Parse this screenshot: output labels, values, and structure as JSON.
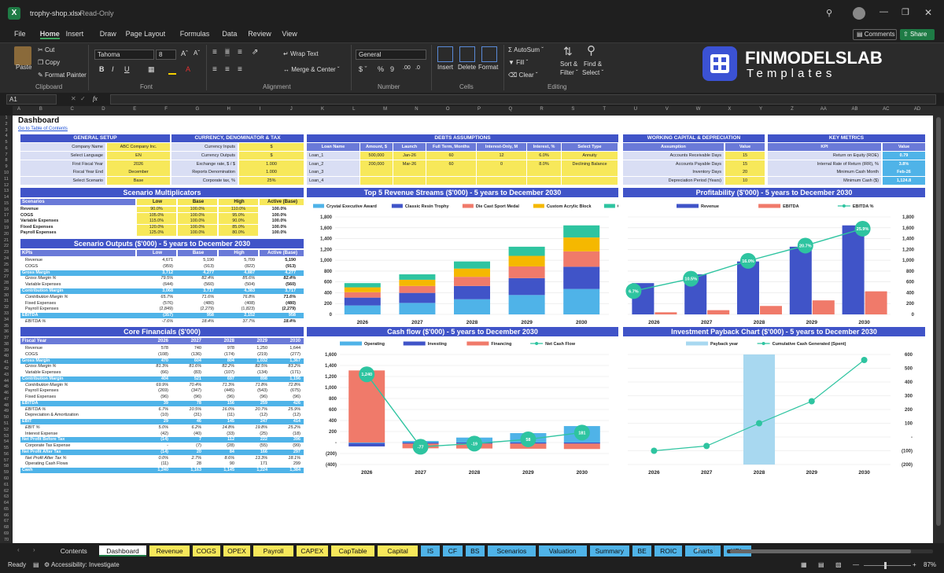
{
  "app": {
    "file": "trophy-shop.xlsx",
    "mode": "Read-Only",
    "comments": "Comments",
    "share": "Share"
  },
  "menu": [
    "File",
    "Home",
    "Insert",
    "Draw",
    "Page Layout",
    "Formulas",
    "Data",
    "Review",
    "View"
  ],
  "ribbon": {
    "cut": "Cut",
    "copy": "Copy",
    "format_painter": "Format Painter",
    "paste": "Paste",
    "clipboard": "Clipboard",
    "font_name": "Tahoma",
    "font_size": "8",
    "font": "Font",
    "wrap": "Wrap Text",
    "merge": "Merge & Center",
    "alignment": "Alignment",
    "number_format": "General",
    "number": "Number",
    "insert": "Insert",
    "delete": "Delete",
    "format": "Format",
    "cells": "Cells",
    "autosum": "AutoSum",
    "fill": "Fill",
    "clear": "Clear",
    "sort": "Sort &",
    "filter": "Filter",
    "find": "Find &",
    "select": "Select",
    "editing": "Editing"
  },
  "logo": {
    "name": "FINMODELSLAB",
    "sub": "Templates"
  },
  "formula": {
    "cell": "A1",
    "fx": "fx"
  },
  "columns": [
    "A",
    "B",
    "C",
    "D",
    "E",
    "F",
    "G",
    "H",
    "I",
    "J",
    "K",
    "L",
    "M",
    "N",
    "O",
    "P",
    "Q",
    "R",
    "S",
    "T",
    "U",
    "V",
    "W",
    "X",
    "Y",
    "Z",
    "AA",
    "AB",
    "AC",
    "AD"
  ],
  "rows": [
    "1",
    "2",
    "3",
    "4",
    "5",
    "6",
    "7",
    "8",
    "9",
    "10",
    "11",
    "12",
    "13",
    "14",
    "15",
    "16",
    "17",
    "18",
    "19",
    "20",
    "21",
    "22",
    "23",
    "24",
    "25",
    "26",
    "27",
    "28",
    "29",
    "30",
    "31",
    "32",
    "33",
    "34",
    "35",
    "36",
    "37",
    "38",
    "39",
    "40",
    "41",
    "42",
    "43",
    "44",
    "45",
    "46",
    "47",
    "48",
    "49",
    "50",
    "51",
    "52",
    "53",
    "54",
    "55",
    "56",
    "57",
    "58",
    "59",
    "60",
    "61",
    "62",
    "63",
    "64",
    "65",
    "66",
    "67",
    "68",
    "69",
    "70"
  ],
  "dashboard": {
    "title": "Dashboard",
    "link": "Go to Table of Contents"
  },
  "general_setup": {
    "title": "GENERAL SETUP",
    "rows": [
      [
        "Company Name",
        "ABC Company Inc."
      ],
      [
        "Select Language",
        "EN"
      ],
      [
        "First Fiscal Year",
        "2026"
      ],
      [
        "Fiscal Year End",
        "December"
      ],
      [
        "Select Scenario",
        "Base"
      ]
    ]
  },
  "currency": {
    "title": "CURRENCY, DENOMINATOR & TAX",
    "rows": [
      [
        "Currency Inputs",
        "$"
      ],
      [
        "Currency Outputs",
        "$"
      ],
      [
        "Exchange rate, $ / $",
        "1.000"
      ],
      [
        "Reports Denomination",
        "1.000"
      ],
      [
        "Corporate tax, %",
        "25%"
      ]
    ]
  },
  "debts": {
    "title": "DEBTS ASSUMPTIONS",
    "headers": [
      "Loan Name",
      "Amount, $",
      "Launch",
      "Full Term, Months",
      "Interest-Only, M",
      "Interest, %",
      "Select Type"
    ],
    "rows": [
      [
        "Loan_1",
        "500,000",
        "Jan-26",
        "60",
        "12",
        "6.0%",
        "Annuity"
      ],
      [
        "Loan_2",
        "200,000",
        "Mar-26",
        "60",
        "0",
        "8.0%",
        "Declining Balance"
      ],
      [
        "Loan_3",
        "",
        "",
        "",
        "",
        "",
        ""
      ],
      [
        "Loan_4",
        "",
        "",
        "",
        "",
        "",
        ""
      ]
    ]
  },
  "working_capital": {
    "title": "WORKING CAPITAL & DEPRECIATION",
    "headers": [
      "Assumption",
      "Value"
    ],
    "rows": [
      [
        "Accounts Receivable Days",
        "15"
      ],
      [
        "Accounts Payable Days",
        "15"
      ],
      [
        "Inventory Days",
        "20"
      ],
      [
        "Depreciation Period (Years)",
        "10"
      ]
    ]
  },
  "key_metrics": {
    "title": "KEY METRICS",
    "headers": [
      "KPI",
      "Value"
    ],
    "rows": [
      [
        "Return on Equity (ROE)",
        "0.79"
      ],
      [
        "Internal Rate of Return (IRR), %",
        "3.8%"
      ],
      [
        "Minimum Cash Month",
        "Feb-26"
      ],
      [
        "Minimum Cash ($)",
        "1,124.8"
      ]
    ]
  },
  "scenario_mult": {
    "title": "Scenario Multiplicators",
    "headers": [
      "Scenarios",
      "Low",
      "Base",
      "High",
      "Active (Base)"
    ],
    "rows": [
      [
        "Revenue",
        "90.0%",
        "100.0%",
        "110.0%",
        "100.0%"
      ],
      [
        "COGS",
        "105.0%",
        "100.0%",
        "95.0%",
        "100.0%"
      ],
      [
        "Variable Expenses",
        "115.0%",
        "100.0%",
        "90.0%",
        "100.0%"
      ],
      [
        "Fixed Expenses",
        "120.0%",
        "100.0%",
        "85.0%",
        "100.0%"
      ],
      [
        "Payroll Expenses",
        "125.0%",
        "100.0%",
        "80.0%",
        "100.0%"
      ]
    ]
  },
  "scenario_out": {
    "title": "Scenario Outputs ($'000) - 5 years to December 2030",
    "headers": [
      "KPIs",
      "Low",
      "Base",
      "High",
      "Active (Base)"
    ],
    "rows": [
      [
        "Revenue",
        "4,671",
        "5,190",
        "5,709",
        "5,190",
        "n"
      ],
      [
        "COGS",
        "(959)",
        "(913)",
        "(822)",
        "(913)",
        "n"
      ],
      [
        "Gross Margin",
        "3,712",
        "4,277",
        "4,887",
        "4,277",
        "h"
      ],
      [
        "Gross Margin %",
        "79.5%",
        "82.4%",
        "85.6%",
        "82.4%",
        "i"
      ],
      [
        "Variable Expenses",
        "(644)",
        "(560)",
        "(504)",
        "(560)",
        "n"
      ],
      [
        "Contribution Margin",
        "3,068",
        "3,717",
        "4,383",
        "3,717",
        "h"
      ],
      [
        "Contribution Margin %",
        "65.7%",
        "71.6%",
        "76.8%",
        "71.6%",
        "i"
      ],
      [
        "Fixed Expenses",
        "(576)",
        "(480)",
        "(408)",
        "(480)",
        "n"
      ],
      [
        "Payroll Expenses",
        "(2,849)",
        "(2,279)",
        "(1,823)",
        "(2,279)",
        "n"
      ],
      [
        "EBITDA",
        "(357)",
        "958",
        "2,152",
        "958",
        "h"
      ],
      [
        "EBITDA %",
        "-7.6%",
        "18.4%",
        "37.7%",
        "18.4%",
        "i"
      ]
    ]
  },
  "core": {
    "title": "Core Financials ($'000)",
    "headers": [
      "Fiscal Year",
      "2026",
      "2027",
      "2028",
      "2029",
      "2030"
    ],
    "rows": [
      [
        "Revenue",
        "578",
        "740",
        "978",
        "1,250",
        "1,644",
        "n"
      ],
      [
        "COGS",
        "(108)",
        "(136)",
        "(174)",
        "(219)",
        "(277)",
        "n"
      ],
      [
        "Gross Margin",
        "470",
        "604",
        "804",
        "1,032",
        "1,367",
        "h"
      ],
      [
        "Gross Margin %",
        "81.3%",
        "81.6%",
        "82.2%",
        "82.5%",
        "83.2%",
        "i"
      ],
      [
        "Variable Expenses",
        "(66)",
        "(83)",
        "(107)",
        "(134)",
        "(171)",
        "n"
      ],
      [
        "Contribution Margin",
        "404",
        "521",
        "697",
        "898",
        "1,196",
        "h"
      ],
      [
        "Contribution Margin %",
        "69.9%",
        "70.4%",
        "71.3%",
        "71.8%",
        "72.8%",
        "i"
      ],
      [
        "Payroll Expenses",
        "(269)",
        "(347)",
        "(445)",
        "(543)",
        "(675)",
        "n"
      ],
      [
        "Fixed Expenses",
        "(96)",
        "(96)",
        "(96)",
        "(96)",
        "(96)",
        "n"
      ],
      [
        "EBITDA",
        "39",
        "78",
        "156",
        "259",
        "426",
        "h"
      ],
      [
        "EBITDA %",
        "6.7%",
        "10.5%",
        "16.0%",
        "20.7%",
        "25.9%",
        "i"
      ],
      [
        "Depreciation & Amortization",
        "(10)",
        "(31)",
        "(11)",
        "(12)",
        "(12)",
        "n"
      ],
      [
        "EBIT",
        "29",
        "46",
        "145",
        "247",
        "414",
        "h"
      ],
      [
        "EBIT %",
        "5.0%",
        "6.2%",
        "14.8%",
        "19.8%",
        "25.2%",
        "i"
      ],
      [
        "Interest Expense",
        "(42)",
        "(40)",
        "(33)",
        "(25)",
        "(18)",
        "n"
      ],
      [
        "Net Profit Before Tax",
        "(14)",
        "7",
        "112",
        "222",
        "396",
        "h"
      ],
      [
        "Corporate Tax Expense",
        "-",
        "(7)",
        "(28)",
        "(55)",
        "(99)",
        "n"
      ],
      [
        "Net Profit After Tax",
        "(14)",
        "20",
        "84",
        "166",
        "297",
        "h"
      ],
      [
        "Net Profit After Tax %",
        "0.0%",
        "2.7%",
        "8.6%",
        "13.3%",
        "18.1%",
        "i"
      ],
      [
        "Operating Cash Flows",
        "(11)",
        "28",
        "90",
        "171",
        "299",
        "n"
      ],
      [
        "Cash",
        "1,240",
        "1,163",
        "1,145",
        "1,224",
        "1,384",
        "h"
      ]
    ]
  },
  "tabs": [
    "Contents",
    "Dashboard",
    "Revenue",
    "COGS",
    "OPEX",
    "Payroll",
    "CAPEX",
    "CapTable",
    "Capital",
    "IS",
    "CF",
    "BS",
    "Scenarios",
    "Valuation",
    "Summary",
    "BE",
    "ROIC",
    "Charts",
    "KPIs"
  ],
  "status": {
    "ready": "Ready",
    "accessibility": "Accessibility: Investigate",
    "zoom": "87%"
  },
  "chart_data": [
    {
      "type": "bar",
      "stacked": true,
      "title": "Top 5 Revenue Streams ($'000) - 5 years to December 2030",
      "categories": [
        "2026",
        "2027",
        "2028",
        "2029",
        "2030"
      ],
      "series": [
        {
          "name": "Crystal Executive Award",
          "color": "#4fb3e8",
          "values": [
            165,
            212,
            280,
            358,
            470
          ]
        },
        {
          "name": "Classic Resin Trophy",
          "color": "#4054c8",
          "values": [
            145,
            185,
            245,
            312,
            410
          ]
        },
        {
          "name": "Die Cast Sport Medal",
          "color": "#f07a6a",
          "values": [
            100,
            128,
            169,
            216,
            284
          ]
        },
        {
          "name": "Custom Acrylic Block",
          "color": "#f5b800",
          "values": [
            90,
            115,
            152,
            195,
            257
          ]
        },
        {
          "name": "Other Revenue",
          "color": "#2ec4a0",
          "values": [
            78,
            100,
            132,
            169,
            223
          ]
        }
      ],
      "ylim": [
        0,
        1800
      ]
    },
    {
      "type": "bar",
      "title": "Profitability ($'000) - 5 years to December 2030",
      "categories": [
        "2026",
        "2027",
        "2028",
        "2029",
        "2030"
      ],
      "series": [
        {
          "name": "Revenue",
          "color": "#4054c8",
          "values": [
            578,
            740,
            978,
            1250,
            1644
          ]
        },
        {
          "name": "EBITDA",
          "color": "#f07a6a",
          "values": [
            39,
            78,
            156,
            259,
            426
          ]
        },
        {
          "name": "EBITDA %",
          "type": "line",
          "color": "#2ec4a0",
          "values": [
            6.7,
            10.5,
            16.0,
            20.7,
            25.9
          ],
          "labels": [
            "6.7%",
            "10.5%",
            "16.0%",
            "20.7%",
            "25.9%"
          ]
        }
      ],
      "ylim": [
        0,
        1800
      ]
    },
    {
      "type": "bar",
      "stacked": true,
      "title": "Cash flow ($'000) - 5 years to December 2030",
      "categories": [
        "2026",
        "2027",
        "2028",
        "2029",
        "2030"
      ],
      "series": [
        {
          "name": "Operating",
          "color": "#4fb3e8",
          "values": [
            -11,
            28,
            90,
            171,
            299
          ]
        },
        {
          "name": "Investing",
          "color": "#4054c8",
          "values": [
            -60,
            -20,
            -20,
            -20,
            -20
          ]
        },
        {
          "name": "Financing",
          "color": "#f07a6a",
          "values": [
            1310,
            -85,
            -89,
            -93,
            -98
          ]
        },
        {
          "name": "Net Cash Flow",
          "type": "line",
          "color": "#2ec4a0",
          "values": [
            1240,
            -77,
            -19,
            58,
            181
          ],
          "labels": [
            "1,240",
            "-77",
            "-19",
            "58",
            "181"
          ]
        }
      ],
      "ylim": [
        -400,
        1600
      ]
    },
    {
      "type": "line",
      "title": "Investment Payback Chart ($'000) - 5 years to December 2030",
      "categories": [
        "2026",
        "2027",
        "2028",
        "2029",
        "2030"
      ],
      "series": [
        {
          "name": "Payback year",
          "type": "bar",
          "color": "#a8d8f0",
          "values": [
            null,
            null,
            600,
            null,
            null
          ]
        },
        {
          "name": "Cumulative Cash Generated (Spent)",
          "color": "#2ec4a0",
          "values": [
            -100,
            -65,
            100,
            260,
            560
          ]
        }
      ],
      "ylim": [
        -200,
        600
      ]
    }
  ]
}
